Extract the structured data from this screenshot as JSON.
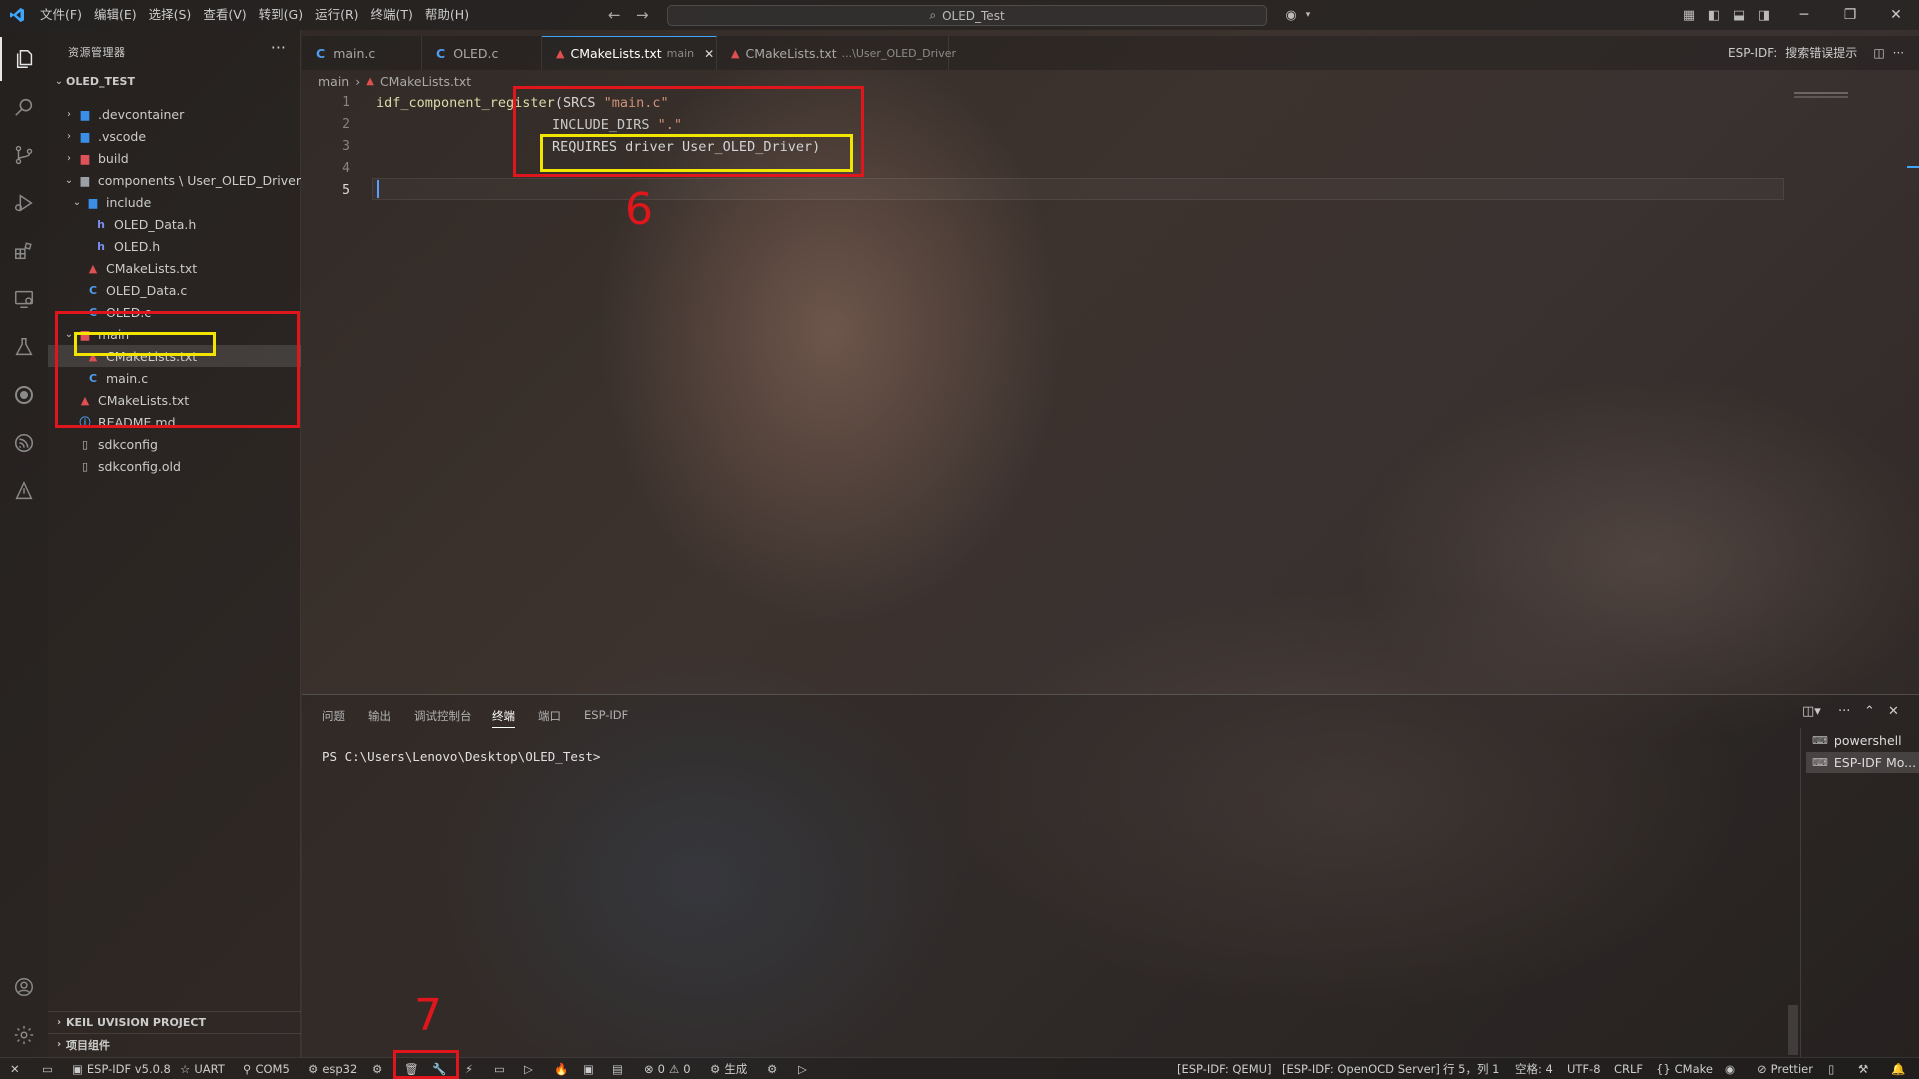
{
  "titlebar": {
    "menus": [
      "文件(F)",
      "编辑(E)",
      "选择(S)",
      "查看(V)",
      "转到(G)",
      "运行(R)",
      "终端(T)",
      "帮助(H)"
    ],
    "search_text": "OLED_Test"
  },
  "sidebar": {
    "title": "资源管理器",
    "more": "···",
    "root": "OLED_TEST",
    "items": [
      {
        "label": ".devcontainer"
      },
      {
        "label": ".vscode"
      },
      {
        "label": "build"
      },
      {
        "label": "components \\ User_OLED_Driver"
      },
      {
        "label": "include"
      },
      {
        "label": "OLED_Data.h"
      },
      {
        "label": "OLED.h"
      },
      {
        "label": "CMakeLists.txt"
      },
      {
        "label": "OLED_Data.c"
      },
      {
        "label": "OLED.c"
      },
      {
        "label": "main"
      },
      {
        "label": "CMakeLists.txt"
      },
      {
        "label": "main.c"
      },
      {
        "label": "CMakeLists.txt"
      },
      {
        "label": "README.md"
      },
      {
        "label": "sdkconfig"
      },
      {
        "label": "sdkconfig.old"
      }
    ],
    "sections": [
      "KEIL UVISION PROJECT",
      "项目组件"
    ]
  },
  "tabs": [
    {
      "label": "main.c",
      "desc": ""
    },
    {
      "label": "OLED.c",
      "desc": ""
    },
    {
      "label": "CMakeLists.txt",
      "desc": "main"
    },
    {
      "label": "CMakeLists.txt",
      "desc": "...\\User_OLED_Driver"
    }
  ],
  "tab_right": {
    "label": "ESP-IDF:",
    "action": "搜索错误提示"
  },
  "breadcrumb": {
    "folder": "main",
    "file": "CMakeLists.txt"
  },
  "editor": {
    "line_numbers": [
      "1",
      "2",
      "3",
      "4",
      "5"
    ],
    "lines": {
      "l1_fn": "idf_component_register",
      "l1_rest": "(SRCS ",
      "l1_str": "\"main.c\"",
      "l2_kw": "INCLUDE_DIRS ",
      "l2_str": "\".\"",
      "l3": "REQUIRES driver User_OLED_Driver)"
    }
  },
  "annotations": {
    "six": "6",
    "seven": "7"
  },
  "panel": {
    "tabs": [
      "问题",
      "输出",
      "调试控制台",
      "终端",
      "端口",
      "ESP-IDF"
    ],
    "terminal_prompt": "PS C:\\Users\\Lenovo\\Desktop\\OLED_Test>",
    "terminals": [
      "powershell",
      "ESP-IDF Mo..."
    ]
  },
  "statusbar": {
    "idf_version": "ESP-IDF v5.0.8",
    "uart": "UART",
    "port": "COM5",
    "target": "esp32",
    "errors": "0",
    "warnings": "0",
    "build": "生成",
    "qemu": "[ESP-IDF: QEMU]",
    "openocd": "[ESP-IDF: OpenOCD Server]",
    "position": "行 5，列 1",
    "spaces": "空格: 4",
    "encoding": "UTF-8",
    "eol": "CRLF",
    "language": "CMake",
    "prettier": "Prettier"
  },
  "colors": {
    "accent": "#3ea6ff",
    "annotation_red": "#e0161c",
    "annotation_yellow": "#f2e600"
  }
}
